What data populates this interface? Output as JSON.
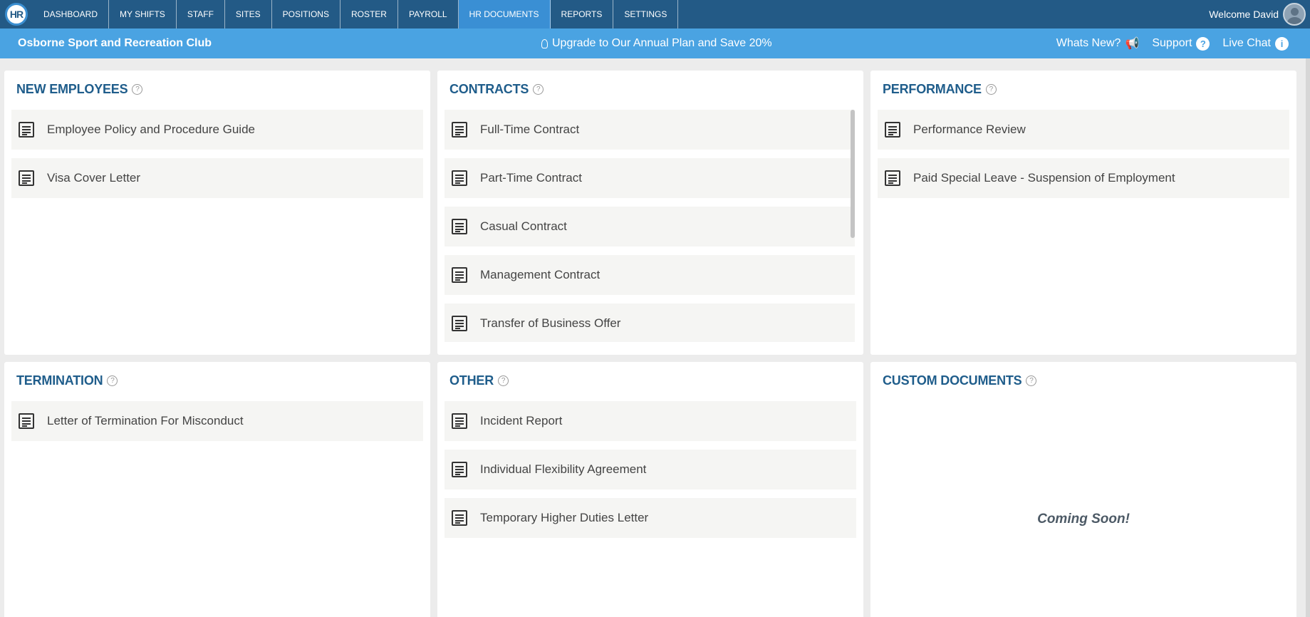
{
  "nav": {
    "logo_text": "HR",
    "tabs": [
      {
        "label": "DASHBOARD"
      },
      {
        "label": "MY SHIFTS"
      },
      {
        "label": "STAFF"
      },
      {
        "label": "SITES"
      },
      {
        "label": "POSITIONS"
      },
      {
        "label": "ROSTER"
      },
      {
        "label": "PAYROLL"
      },
      {
        "label": "HR DOCUMENTS",
        "active": true
      },
      {
        "label": "REPORTS"
      },
      {
        "label": "SETTINGS"
      }
    ],
    "welcome": "Welcome David"
  },
  "subbar": {
    "org_name": "Osborne Sport and Recreation Club",
    "promo": "Upgrade to Our Annual Plan and Save 20%",
    "whats_new": "Whats New?",
    "support": "Support",
    "live_chat": "Live Chat"
  },
  "sections": {
    "new_employees": {
      "title": "NEW EMPLOYEES",
      "items": [
        "Employee Policy and Procedure Guide",
        "Visa Cover Letter"
      ]
    },
    "contracts": {
      "title": "CONTRACTS",
      "items": [
        "Full-Time Contract",
        "Part-Time Contract",
        "Casual Contract",
        "Management Contract",
        "Transfer of Business Offer"
      ]
    },
    "performance": {
      "title": "PERFORMANCE",
      "items": [
        "Performance Review",
        "Paid Special Leave - Suspension of Employment"
      ]
    },
    "termination": {
      "title": "TERMINATION",
      "items": [
        "Letter of Termination For Misconduct"
      ]
    },
    "other": {
      "title": "OTHER",
      "items": [
        "Incident Report",
        "Individual Flexibility Agreement",
        "Temporary Higher Duties Letter"
      ]
    },
    "custom": {
      "title": "CUSTOM DOCUMENTS",
      "message": "Coming Soon!"
    }
  }
}
